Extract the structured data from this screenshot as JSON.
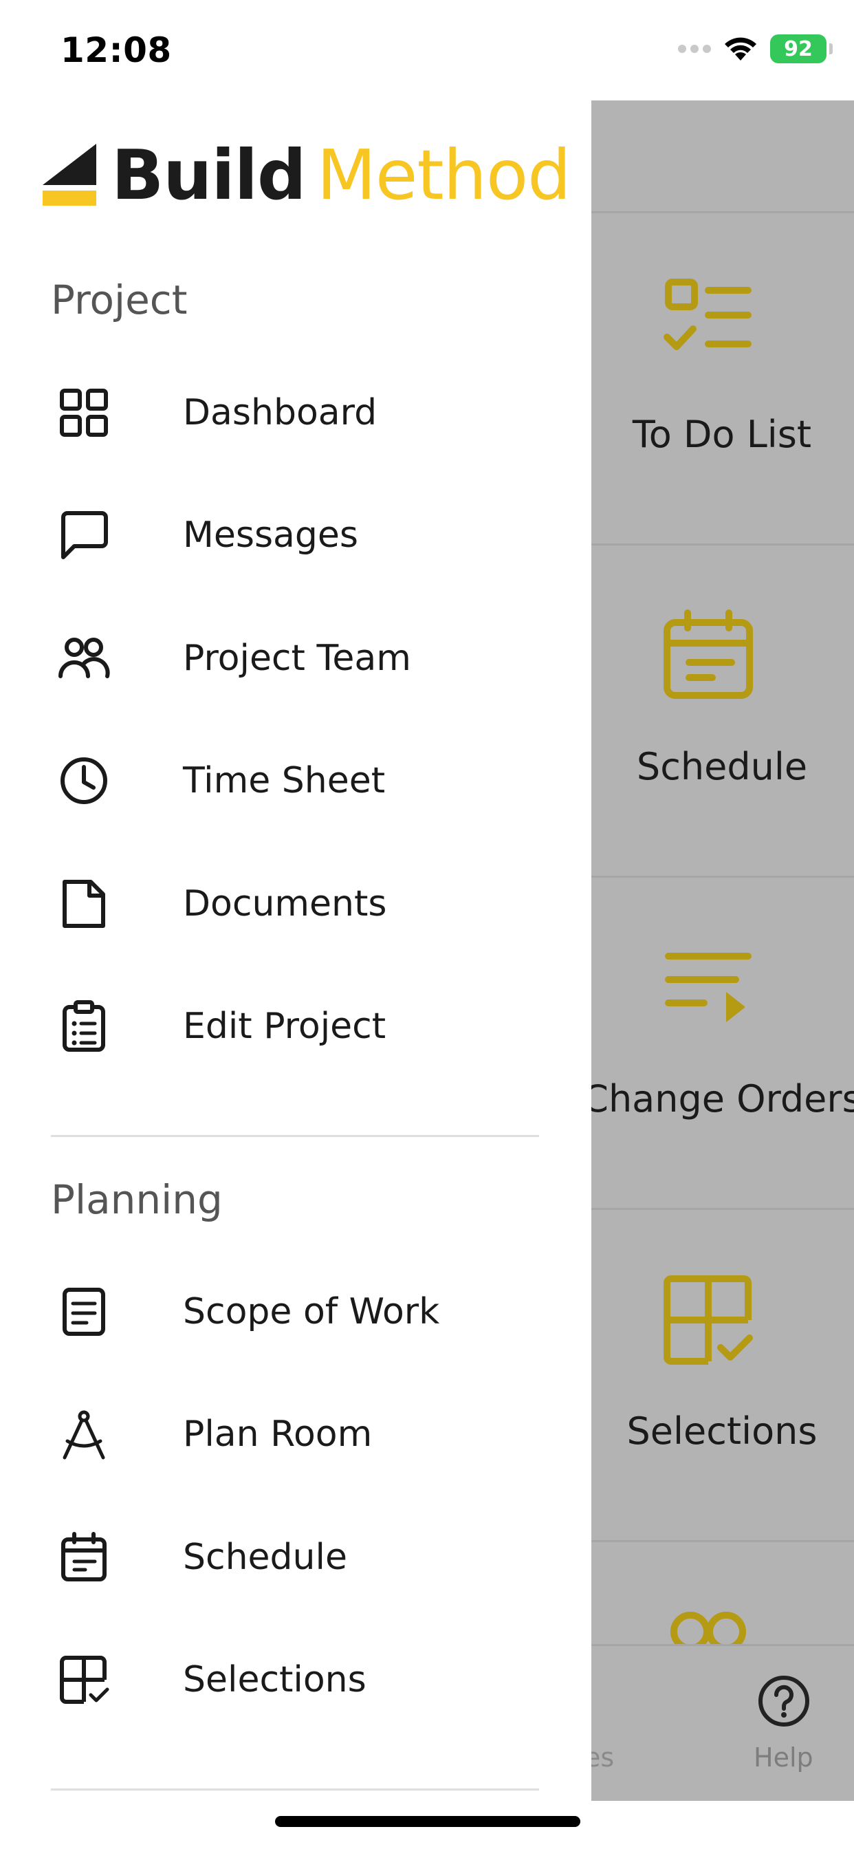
{
  "status_bar": {
    "time": "12:08",
    "battery": "92"
  },
  "brand": {
    "name_part1": "Build",
    "name_part2": "Method",
    "accent_color": "#f7c623"
  },
  "drawer": {
    "sections": [
      {
        "title": "Project",
        "items": [
          {
            "label": "Dashboard",
            "icon": "grid-icon"
          },
          {
            "label": "Messages",
            "icon": "chat-bubble-icon"
          },
          {
            "label": "Project Team",
            "icon": "team-icon"
          },
          {
            "label": "Time Sheet",
            "icon": "clock-icon"
          },
          {
            "label": "Documents",
            "icon": "document-icon"
          },
          {
            "label": "Edit Project",
            "icon": "clipboard-icon"
          }
        ]
      },
      {
        "title": "Planning",
        "items": [
          {
            "label": "Scope of Work",
            "icon": "list-doc-icon"
          },
          {
            "label": "Plan Room",
            "icon": "compass-icon"
          },
          {
            "label": "Schedule",
            "icon": "calendar-icon"
          },
          {
            "label": "Selections",
            "icon": "selections-icon"
          }
        ]
      }
    ]
  },
  "background": {
    "tiles": [
      {
        "label": "To Do List",
        "icon": "todo-icon"
      },
      {
        "label": "Schedule",
        "icon": "calendar-icon"
      },
      {
        "label": "Change Orders",
        "icon": "change-orders-icon"
      },
      {
        "label": "Selections",
        "icon": "selections-icon"
      }
    ],
    "bottom_tabs": [
      {
        "label": "es"
      },
      {
        "label": "Help",
        "icon": "help-icon"
      }
    ]
  }
}
